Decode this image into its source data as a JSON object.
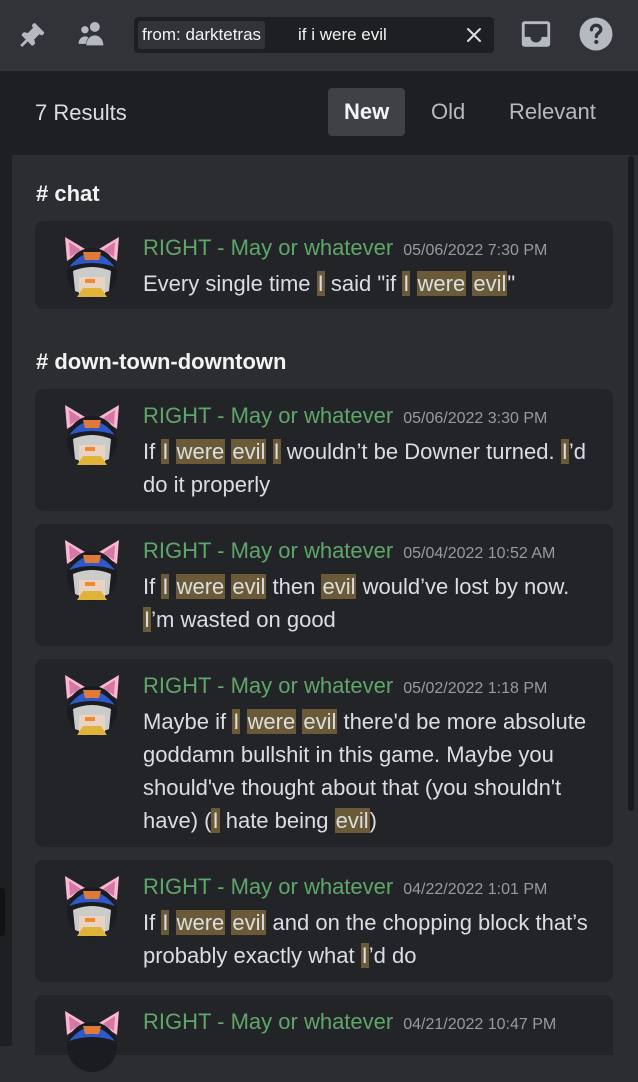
{
  "search": {
    "filter_chip": "from: darktetras",
    "query": "if i were evil"
  },
  "header": {
    "results_count": "7 Results",
    "sort": {
      "new": "New",
      "old": "Old",
      "relevant": "Relevant"
    }
  },
  "channels": [
    "# chat",
    "# down-town-downtown"
  ],
  "messages": [
    {
      "author": "RIGHT - May or whatever",
      "timestamp": "05/06/2022 7:30 PM",
      "text": "Every single time I said \"if I were evil\""
    },
    {
      "author": "RIGHT - May or whatever",
      "timestamp": "05/06/2022 3:30 PM",
      "text": "If I were evil I wouldn’t be Downer turned. I’d do it properly"
    },
    {
      "author": "RIGHT - May or whatever",
      "timestamp": "05/04/2022 10:52 AM",
      "text": "If I were evil then evil would’ve lost by now. I’m wasted on good"
    },
    {
      "author": "RIGHT - May or whatever",
      "timestamp": "05/02/2022 1:18 PM",
      "text": "Maybe if I were evil there'd be more absolute goddamn bullshit in this game. Maybe you should've thought about that (you shouldn't have) (I hate being evil)"
    },
    {
      "author": "RIGHT - May or whatever",
      "timestamp": "04/22/2022 1:01 PM",
      "text": "If I were evil and on the chopping block that’s probably exactly what I’d do"
    },
    {
      "author": "RIGHT - May or whatever",
      "timestamp": "04/21/2022 10:47 PM",
      "text": ""
    }
  ]
}
